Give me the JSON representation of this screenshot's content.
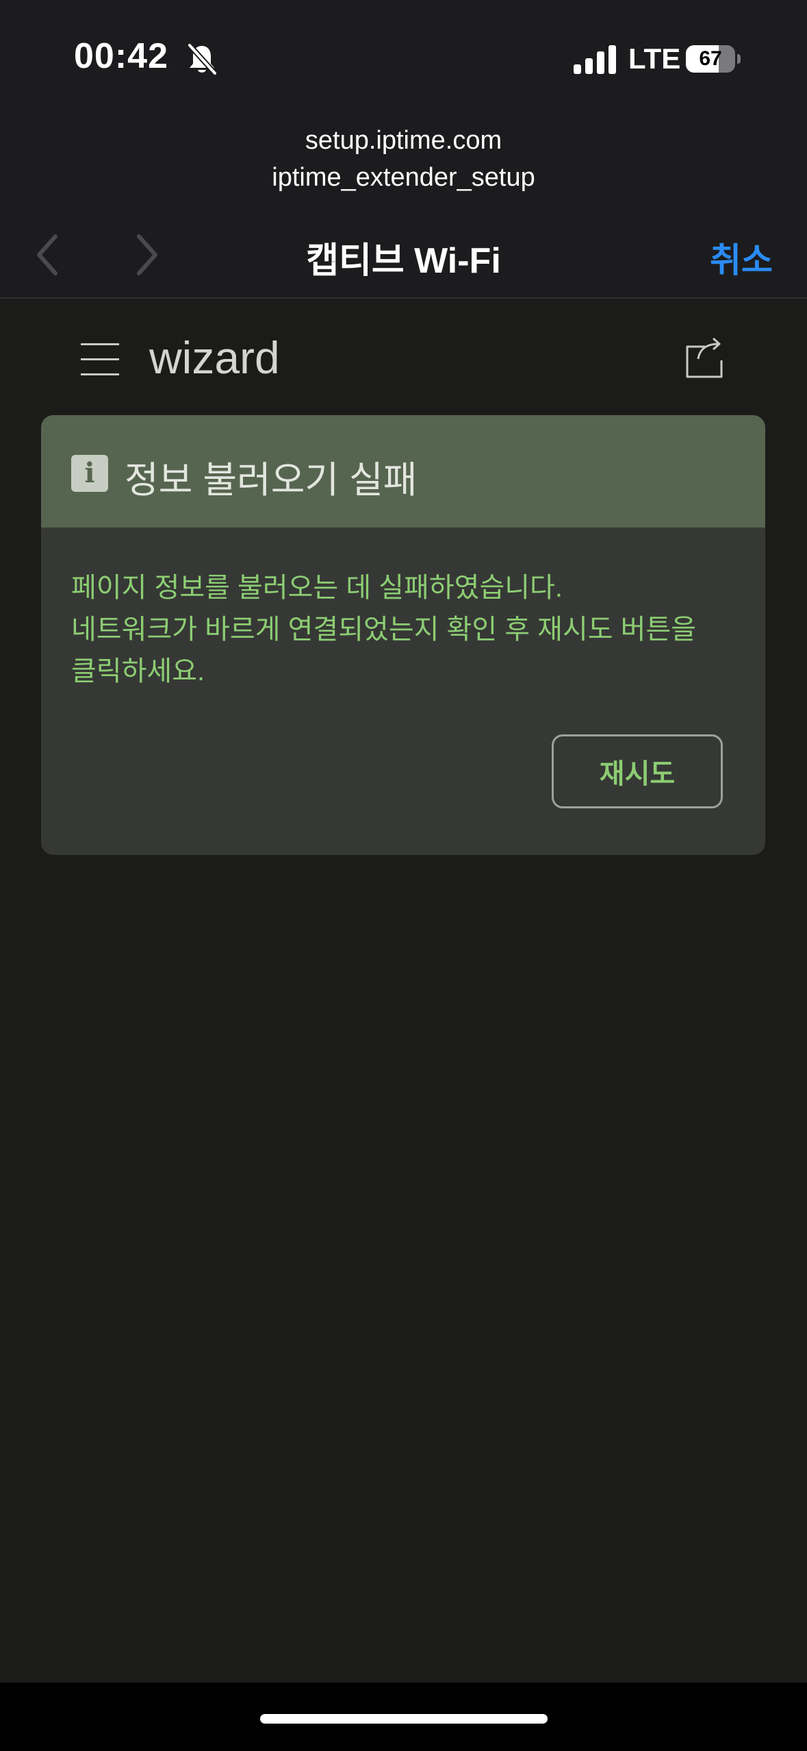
{
  "status_bar": {
    "time": "00:42",
    "network": "LTE",
    "battery_percent": 67,
    "battery_label": "67",
    "signal_bars": 4,
    "silent_mode": true
  },
  "browser": {
    "url_host": "setup.iptime.com",
    "url_path": "iptime_extender_setup",
    "title": "캡티브 Wi-Fi",
    "cancel_label": "취소",
    "accent_color": "#2a8cf4"
  },
  "page": {
    "title": "wizard",
    "icons": [
      "menu-icon",
      "share-icon"
    ]
  },
  "alert": {
    "icon": "info-icon",
    "icon_glyph": "i",
    "title": "정보 불러오기 실패",
    "message_lines": [
      "페이지 정보를 불러오는 데 실패하였습니다.",
      "네트워크가 바르게 연결되었는지 확인 후 재시도 버튼을",
      "클릭하세요."
    ],
    "retry_label": "재시도",
    "header_color": "#56654f",
    "message_color": "#8ccd73"
  }
}
